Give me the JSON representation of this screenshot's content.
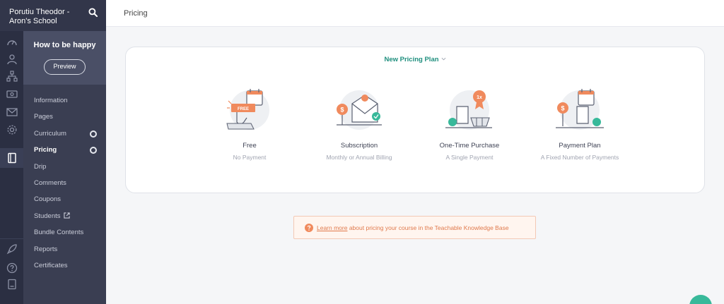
{
  "school": {
    "name": "Porutiu Theodor - Aron's School"
  },
  "course": {
    "title": "How to be happy",
    "preview_label": "Preview"
  },
  "nav": {
    "information": "Information",
    "pages": "Pages",
    "curriculum": "Curriculum",
    "pricing": "Pricing",
    "drip": "Drip",
    "comments": "Comments",
    "coupons": "Coupons",
    "students": "Students",
    "bundle_contents": "Bundle Contents",
    "reports": "Reports",
    "certificates": "Certificates"
  },
  "page": {
    "title": "Pricing"
  },
  "pricing": {
    "dropdown_label": "New Pricing Plan",
    "plans": [
      {
        "name": "Free",
        "desc": "No Payment",
        "badge": "FREE"
      },
      {
        "name": "Subscription",
        "desc": "Monthly or Annual Billing",
        "badge": "$"
      },
      {
        "name": "One-Time Purchase",
        "desc": "A Single Payment",
        "badge": "1x"
      },
      {
        "name": "Payment Plan",
        "desc": "A Fixed Number of Payments",
        "badge": "$"
      }
    ]
  },
  "info": {
    "link_text": "Learn more",
    "rest_text": " about pricing your course in the Teachable Knowledge Base"
  },
  "colors": {
    "sidebar_dark": "#2b2f42",
    "sidebar": "#3a3e52",
    "accent_teal": "#1f8f7e",
    "accent_orange": "#f08a5d",
    "help_green": "#38b99a"
  }
}
